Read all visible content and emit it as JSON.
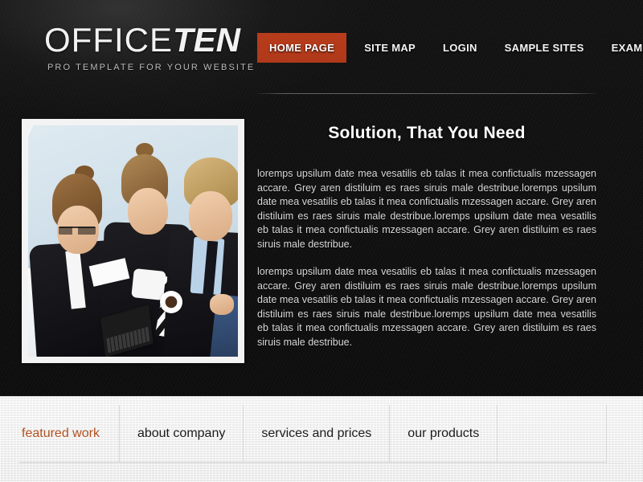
{
  "site": {
    "logo_primary": "OFFICE",
    "logo_secondary": "TEN",
    "tagline": "PRO TEMPLATE FOR YOUR WEBSITE"
  },
  "colors": {
    "accent": "#b0391a",
    "tab_active": "#b0501f",
    "page_background": "#0d0d0d",
    "bottom_panel": "#efefef",
    "body_text": "#d8d8d8"
  },
  "mainnav": {
    "items": [
      {
        "label": "HOME PAGE",
        "active": true
      },
      {
        "label": "SITE MAP",
        "active": false
      },
      {
        "label": "LOGIN",
        "active": false
      },
      {
        "label": "SAMPLE SITES",
        "active": false
      },
      {
        "label": "EXAMPLE PAGES",
        "active": false
      }
    ]
  },
  "article": {
    "title": "Solution, That You Need",
    "paragraph_1": "loremps upsilum date mea vesatilis eb talas it mea confictualis mzessagen accare. Grey aren distiluim es raes siruis male destribue.loremps upsilum date mea vesatilis eb talas it mea confictualis mzessagen accare. Grey aren distiluim es raes siruis male destribue.loremps upsilum date mea vesatilis eb talas it mea confictualis mzessagen accare. Grey aren distiluim es raes siruis male destribue.",
    "paragraph_2": "loremps upsilum date mea vesatilis eb talas it mea confictualis mzessagen accare. Grey aren distiluim es raes siruis male destribue.loremps upsilum date mea vesatilis eb talas it mea confictualis mzessagen accare. Grey aren distiluim es raes siruis male destribue.loremps upsilum date mea vesatilis eb talas it mea confictualis mzessagen accare. Grey aren distiluim es raes siruis male destribue."
  },
  "feature_image": {
    "alt": "three business colleagues in dark suits reviewing documents around a white table with a laptop and coffee cup"
  },
  "bottom_tabs": {
    "items": [
      {
        "label": "featured work",
        "active": true
      },
      {
        "label": "about company",
        "active": false
      },
      {
        "label": "services and prices",
        "active": false
      },
      {
        "label": "our products",
        "active": false
      }
    ]
  }
}
